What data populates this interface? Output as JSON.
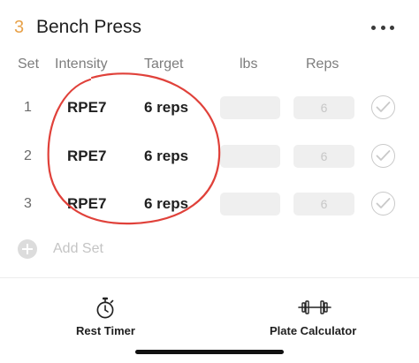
{
  "exercise": {
    "number": "3",
    "title": "Bench Press"
  },
  "columns": {
    "set": "Set",
    "intensity": "Intensity",
    "target": "Target",
    "lbs": "lbs",
    "reps": "Reps"
  },
  "sets": [
    {
      "set": "1",
      "intensity": "RPE7",
      "target": "6 reps",
      "reps_placeholder": "6"
    },
    {
      "set": "2",
      "intensity": "RPE7",
      "target": "6 reps",
      "reps_placeholder": "6"
    },
    {
      "set": "3",
      "intensity": "RPE7",
      "target": "6 reps",
      "reps_placeholder": "6"
    }
  ],
  "add_set": {
    "label": "Add Set"
  },
  "bottom_bar": {
    "rest_timer": {
      "label": "Rest Timer",
      "icon": "stopwatch-icon"
    },
    "plate_calculator": {
      "label": "Plate Calculator",
      "icon": "barbell-icon"
    }
  },
  "colors": {
    "accent": "#e8a24a",
    "annotation": "#e0413a"
  }
}
